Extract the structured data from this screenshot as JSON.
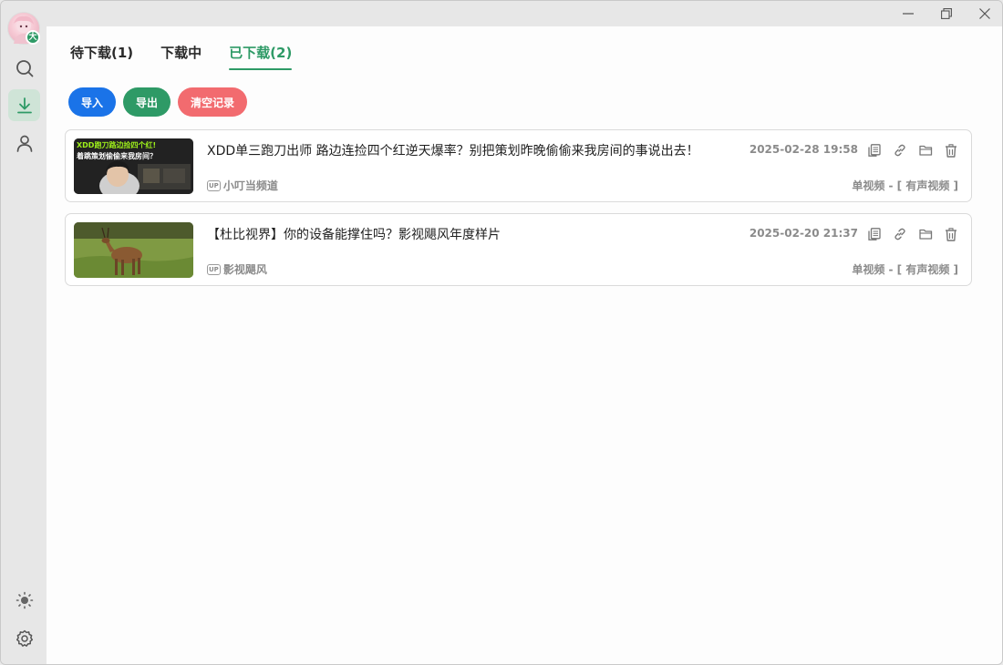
{
  "window": {
    "minimize_icon": "minimize-icon",
    "restore_icon": "restore-icon",
    "close_icon": "close-icon"
  },
  "sidebar": {
    "avatar_badge": "大",
    "items": [
      {
        "name": "search",
        "icon": "search-icon",
        "active": false
      },
      {
        "name": "download",
        "icon": "download-icon",
        "active": true
      },
      {
        "name": "user",
        "icon": "user-icon",
        "active": false
      }
    ],
    "bottom_items": [
      {
        "name": "theme",
        "icon": "sun-icon"
      },
      {
        "name": "settings",
        "icon": "gear-icon"
      }
    ]
  },
  "tabs": [
    {
      "label": "待下载(1)",
      "active": false
    },
    {
      "label": "下载中",
      "active": false
    },
    {
      "label": "已下载(2)",
      "active": true
    }
  ],
  "actions": {
    "import_label": "导入",
    "export_label": "导出",
    "clear_label": "清空记录"
  },
  "colors": {
    "accent": "#2e9a66",
    "import": "#1a73e8",
    "clear": "#f26b6f"
  },
  "downloads": [
    {
      "title": "XDD单三跑刀出师 路边连捡四个红逆天爆率？别把策划昨晚偷偷来我房间的事说出去！",
      "date": "2025-02-28 19:58",
      "up_badge": "UP",
      "uploader": "小叮当频道",
      "type": "单视频 - [ 有声视频 ]",
      "thumb_text_1": "XDD跑刀路边捡四个红!",
      "thumb_text_2": "着跳策划偷偷来我房间？"
    },
    {
      "title": "【杜比视界】你的设备能撑住吗？影视飓风年度样片",
      "date": "2025-02-20 21:37",
      "up_badge": "UP",
      "uploader": "影视飓风",
      "type": "单视频 - [ 有声视频 ]"
    }
  ]
}
